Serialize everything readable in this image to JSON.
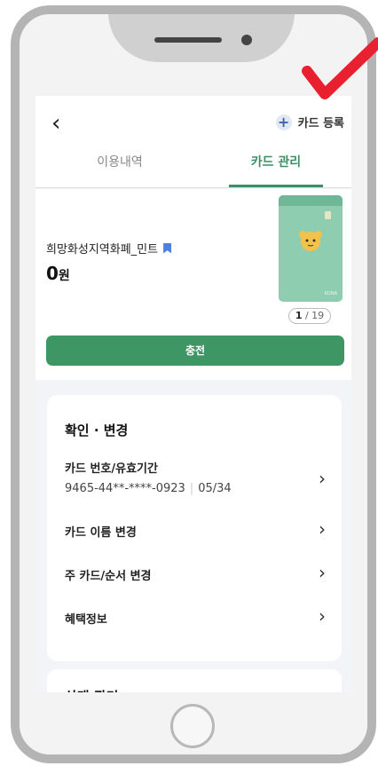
{
  "header": {
    "back_icon": "chevron-left-icon",
    "add_card_label": "카드 등록"
  },
  "tabs": [
    {
      "label": "이용내역",
      "active": false
    },
    {
      "label": "카드 관리",
      "active": true
    }
  ],
  "card": {
    "name": "희망화성지역화폐_민트",
    "balance": "0",
    "currency": "원",
    "index_current": "1",
    "index_total": "/ 19",
    "brand_text": "KONA",
    "color": "#8fcdb0"
  },
  "charge_button": "충전",
  "section_confirm": {
    "title": "확인 · 변경",
    "items": [
      {
        "label": "카드 번호/유효기간",
        "card_number": "9465-44**-****-0923",
        "expiry": "05/34"
      },
      {
        "label": "카드 이름 변경"
      },
      {
        "label": "주 카드/순서 변경"
      },
      {
        "label": "혜택정보"
      }
    ]
  },
  "section_status": {
    "title": "상태 관리"
  },
  "colors": {
    "accent": "#3e9665",
    "annotation_check": "#e8202f"
  }
}
